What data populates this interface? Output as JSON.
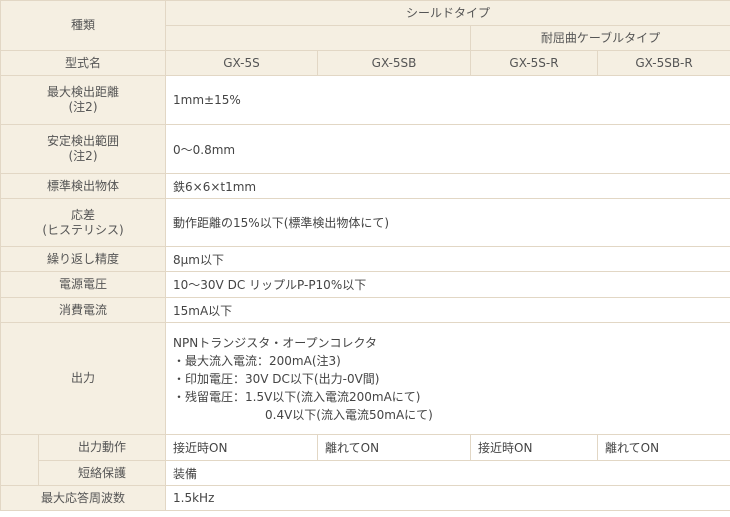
{
  "header": {
    "type_label": "種類",
    "shield_type": "シールドタイプ",
    "flex_cable_type": "耐屈曲ケーブルタイプ",
    "model_label": "型式名",
    "models": [
      "GX-5S",
      "GX-5SB",
      "GX-5S-R",
      "GX-5SB-R"
    ]
  },
  "rows": {
    "max_distance": {
      "label1": "最大検出距離",
      "label2": "(注2)",
      "value": "1mm±15%"
    },
    "stable_range": {
      "label1": "安定検出範囲",
      "label2": "(注2)",
      "value": "0〜0.8mm"
    },
    "std_object": {
      "label": "標準検出物体",
      "value": "鉄6×6×t1mm"
    },
    "hysteresis": {
      "label1": "応差",
      "label2": "(ヒステリシス)",
      "value": "動作距離の15%以下(標準検出物体にて)"
    },
    "repeatability": {
      "label": "繰り返し精度",
      "value": "8μm以下"
    },
    "supply_voltage": {
      "label": "電源電圧",
      "value": "10〜30V DC リップルP-P10%以下"
    },
    "current_consumption": {
      "label": "消費電流",
      "value": "15mA以下"
    },
    "output": {
      "label": "出力",
      "lines": [
        "NPNトランジスタ・オープンコレクタ",
        "・最大流入電流：200mA(注3)",
        "・印加電圧：30V DC以下(出力-0V間)",
        "・残留電圧：1.5V以下(流入電流200mAにて)",
        "0.4V以下(流入電流50mAにて)"
      ]
    },
    "output_operation": {
      "label": "出力動作",
      "values": [
        "接近時ON",
        "離れてON",
        "接近時ON",
        "離れてON"
      ]
    },
    "short_protection": {
      "label": "短絡保護",
      "value": "装備"
    },
    "max_response_freq": {
      "label": "最大応答周波数",
      "value": "1.5kHz"
    }
  }
}
